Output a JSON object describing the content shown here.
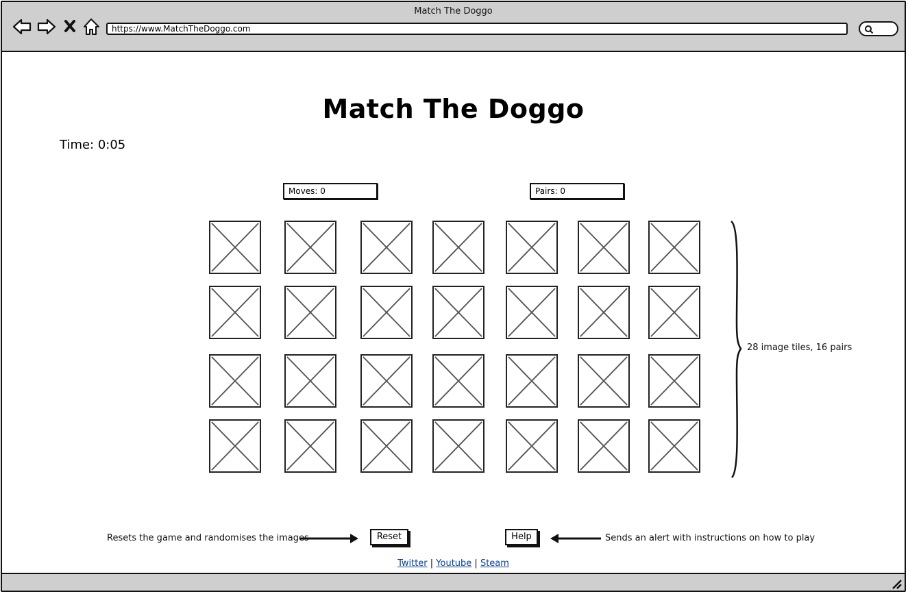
{
  "browser": {
    "window_title": "Match The Doggo",
    "url": "https://www.MatchTheDoggo.com"
  },
  "game": {
    "title": "Match The Doggo",
    "time_label": "Time: 0:05",
    "moves_label": "Moves: 0",
    "pairs_label": "Pairs: 0",
    "tile_rows": 4,
    "tile_columns": 7,
    "tiles_annotation": "28 image tiles, 16 pairs"
  },
  "controls": {
    "reset_label": "Reset",
    "reset_note": "Resets the game and randomises the images",
    "help_label": "Help",
    "help_note": "Sends an alert with instructions on how to play"
  },
  "footer_links": {
    "twitter": "Twitter",
    "youtube": "Youtube",
    "steam": "Steam",
    "separator": " | "
  },
  "icons": [
    "back-arrow-icon",
    "forward-arrow-icon",
    "close-icon",
    "home-icon",
    "search-icon",
    "resize-handle-icon"
  ],
  "colors": {
    "chrome": "#cfcfcf",
    "link": "#0b3f8c",
    "border": "#111111"
  }
}
